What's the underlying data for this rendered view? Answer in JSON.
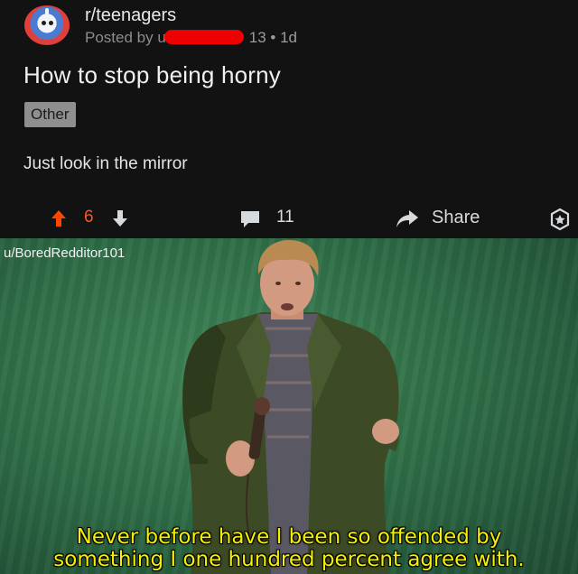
{
  "post": {
    "subreddit": "r/teenagers",
    "posted_by_prefix": "Posted by u",
    "score_time": "13 • 1d",
    "title": "How to stop being horny",
    "flair": "Other",
    "body": "Just look in the mirror",
    "upvotes": "6",
    "comments": "11",
    "share_label": "Share"
  },
  "meme": {
    "username": "u/BoredRedditor101",
    "caption_line1": "Never before have I been so offended by",
    "caption_line2": "something I one hundred percent agree with."
  },
  "colors": {
    "background": "#121212",
    "upvote": "#ff4500",
    "redaction": "#ee0000",
    "caption": "#f4f000"
  },
  "icons": [
    "subreddit-avatar-icon",
    "upvote-icon",
    "downvote-icon",
    "comment-icon",
    "share-icon",
    "award-icon"
  ]
}
